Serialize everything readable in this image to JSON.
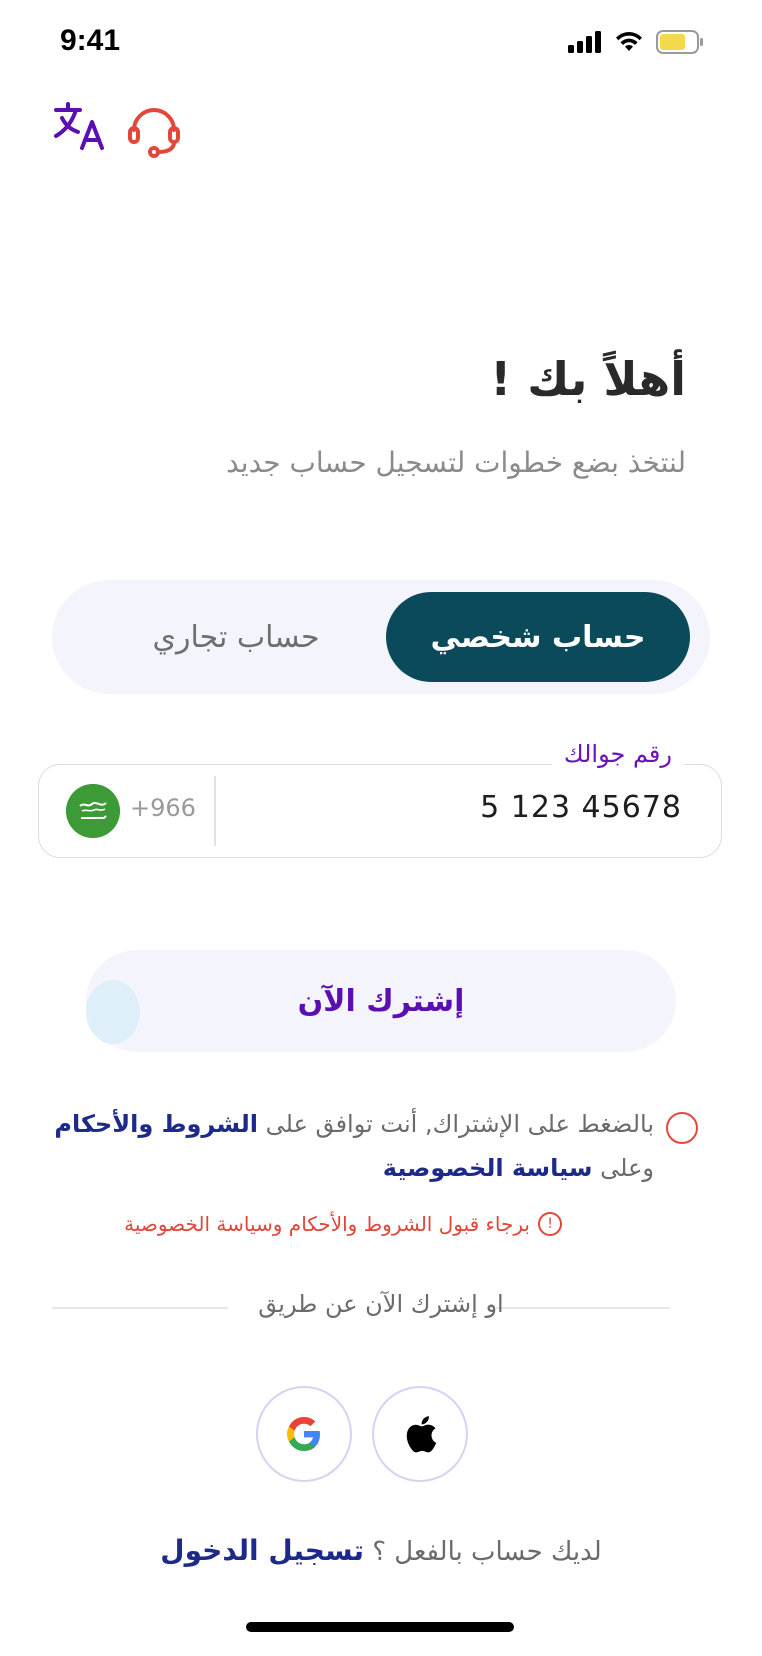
{
  "status_bar": {
    "time": "9:41"
  },
  "header": {
    "translate_icon": "translate-icon",
    "support_icon": "headset-icon"
  },
  "welcome": {
    "title": "أهلاً بك !",
    "subtitle": "لنتخذ بضع خطوات لتسجيل حساب جديد"
  },
  "account_type": {
    "active": "حساب شخصي",
    "inactive": "حساب تجاري"
  },
  "phone": {
    "label": "رقم جوالك",
    "value": "5 123 45678",
    "country_code": "+966",
    "flag_icon": "saudi-flag-icon"
  },
  "subscribe": {
    "label": "إشترك الآن"
  },
  "terms": {
    "line1_prefix": "بالضغط على الإشتراك, أنت توافق على ",
    "line1_link": "الشروط والأحكام",
    "line2_prefix": "وعلى ",
    "line2_link": "سياسة الخصوصية",
    "error": "برجاء قبول الشروط والأحكام وسياسة الخصوصية"
  },
  "divider": {
    "text": "او إشترك الآن عن طريق"
  },
  "social": {
    "google_icon": "google-icon",
    "apple_icon": "apple-icon"
  },
  "login": {
    "prompt": "لديك حساب بالفعل ؟ ",
    "link": "تسجيل الدخول"
  },
  "colors": {
    "primary": "#0b4a5b",
    "accent": "#5b0fb2",
    "error": "#e0463a",
    "link": "#1e2a8a"
  }
}
